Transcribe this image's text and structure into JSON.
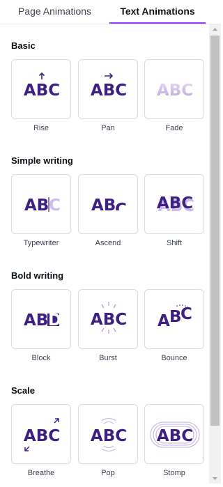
{
  "tabs": [
    {
      "label": "Page Animations"
    },
    {
      "label": "Text Animations"
    }
  ],
  "preview_text": "ABC",
  "accent_color": "#8b3dff",
  "text_color": "#3f1f84",
  "sections": [
    {
      "title": "Basic",
      "items": [
        {
          "label": "Rise",
          "icon": "rise-preview-icon"
        },
        {
          "label": "Pan",
          "icon": "pan-preview-icon"
        },
        {
          "label": "Fade",
          "icon": "fade-preview-icon"
        }
      ]
    },
    {
      "title": "Simple writing",
      "items": [
        {
          "label": "Typewriter",
          "icon": "typewriter-preview-icon"
        },
        {
          "label": "Ascend",
          "icon": "ascend-preview-icon"
        },
        {
          "label": "Shift",
          "icon": "shift-preview-icon"
        }
      ]
    },
    {
      "title": "Bold writing",
      "items": [
        {
          "label": "Block",
          "icon": "block-preview-icon"
        },
        {
          "label": "Burst",
          "icon": "burst-preview-icon"
        },
        {
          "label": "Bounce",
          "icon": "bounce-preview-icon"
        }
      ]
    },
    {
      "title": "Scale",
      "items": [
        {
          "label": "Breathe",
          "icon": "breathe-preview-icon"
        },
        {
          "label": "Pop",
          "icon": "pop-preview-icon"
        },
        {
          "label": "Stomp",
          "icon": "stomp-preview-icon"
        }
      ]
    }
  ]
}
